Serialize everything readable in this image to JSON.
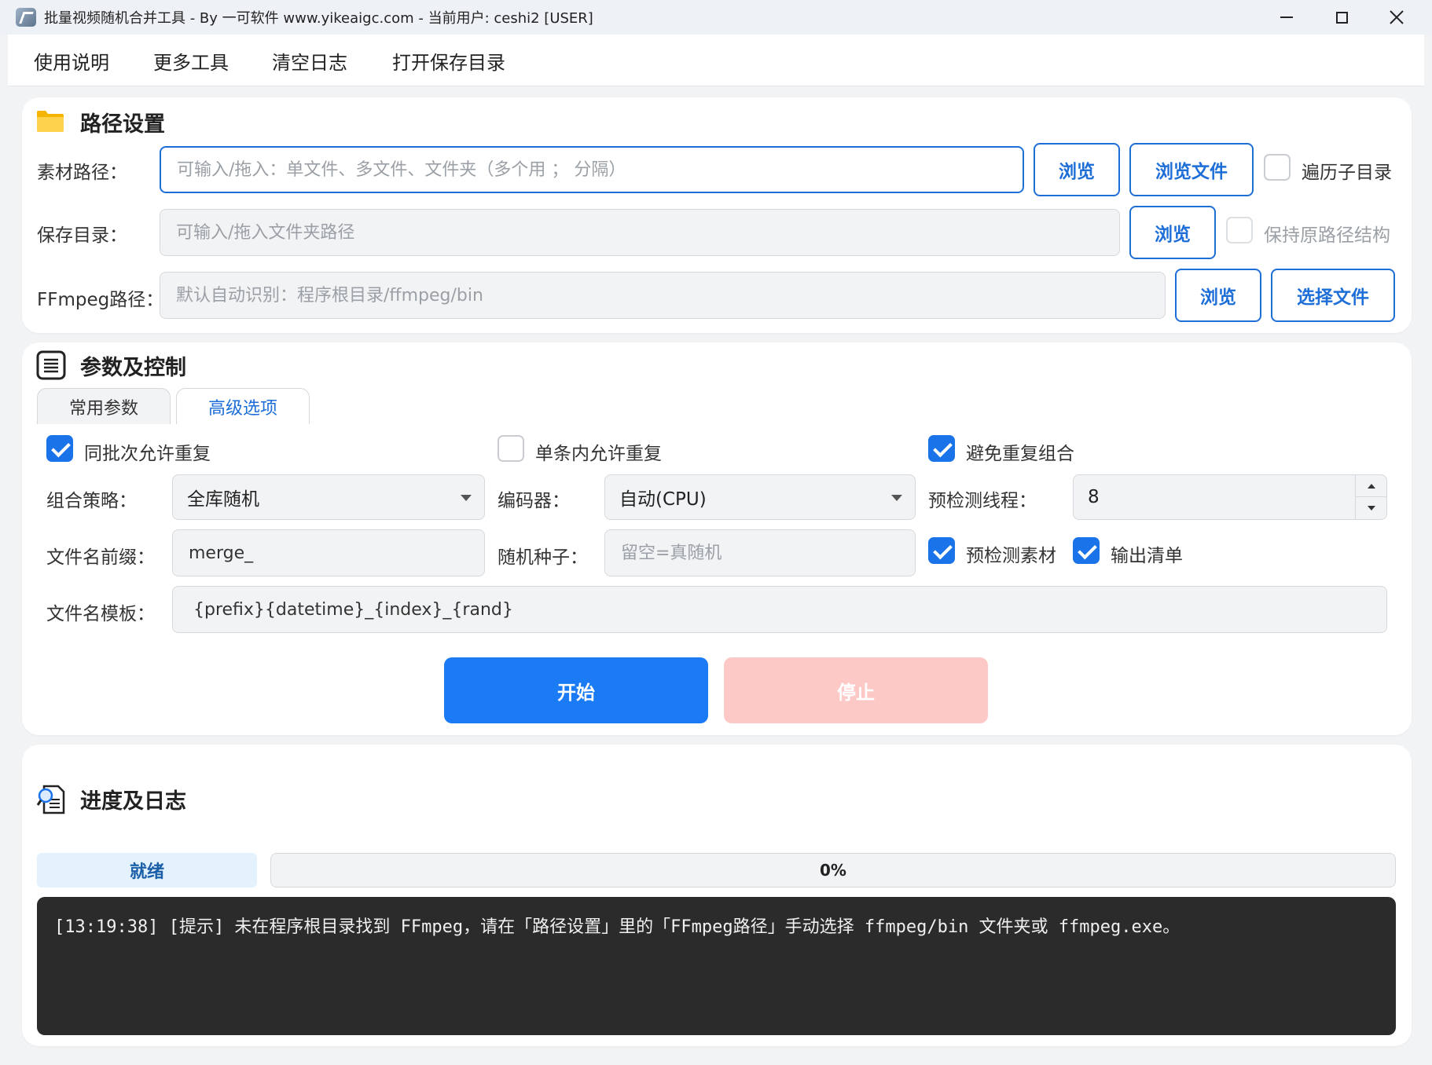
{
  "window": {
    "title": "批量视频随机合并工具 - By 一可软件 www.yikeaigc.com  -  当前用户: ceshi2 [USER]"
  },
  "menu": [
    "使用说明",
    "更多工具",
    "清空日志",
    "打开保存目录"
  ],
  "path_section": {
    "title": "路径设置",
    "material_label": "素材路径：",
    "material_placeholder": "可输入/拖入：单文件、多文件、文件夹（多个用 ； 分隔）",
    "browse": "浏览",
    "browse_file": "浏览文件",
    "traverse_label": "遍历子目录",
    "save_label": "保存目录：",
    "save_placeholder": "可输入/拖入文件夹路径",
    "keep_structure_label": "保持原路径结构",
    "ffmpeg_label": "FFmpeg路径：",
    "ffmpeg_placeholder": "默认自动识别：程序根目录/ffmpeg/bin",
    "select_file": "选择文件"
  },
  "params_section": {
    "title": "参数及控制",
    "tabs": [
      "常用参数",
      "高级选项"
    ],
    "active_tab": "高级选项",
    "allow_repeat_batch": "同批次允许重复",
    "allow_repeat_single": "单条内允许重复",
    "avoid_repeat_combo": "避免重复组合",
    "strategy_label": "组合策略：",
    "strategy_value": "全库随机",
    "encoder_label": "编码器：",
    "encoder_value": "自动(CPU)",
    "precheck_threads_label": "预检测线程：",
    "precheck_threads_value": "8",
    "prefix_label": "文件名前缀：",
    "prefix_value": "merge_",
    "seed_label": "随机种子：",
    "seed_placeholder": "留空=真随机",
    "precheck_material": "预检测素材",
    "output_list": "输出清单",
    "template_label": "文件名模板：",
    "template_value": "{prefix}{datetime}_{index}_{rand}",
    "start": "开始",
    "stop": "停止"
  },
  "log_section": {
    "title": "进度及日志",
    "status": "就绪",
    "progress_text": "0%",
    "progress_value": 0,
    "log_lines": [
      "[13:19:38] [提示] 未在程序根目录找到 FFmpeg，请在「路径设置」里的「FFmpeg路径」手动选择 ffmpeg/bin 文件夹或 ffmpeg.exe。"
    ]
  },
  "colors": {
    "accent": "#1a73e8",
    "start_button": "#1a7bf5",
    "stop_button": "#fdc9c6",
    "log_bg": "#2b2b2b",
    "status_bg": "#e3f2fd"
  },
  "icons": {
    "folder": "folder-icon",
    "list": "list-icon",
    "log": "search-document-icon"
  }
}
